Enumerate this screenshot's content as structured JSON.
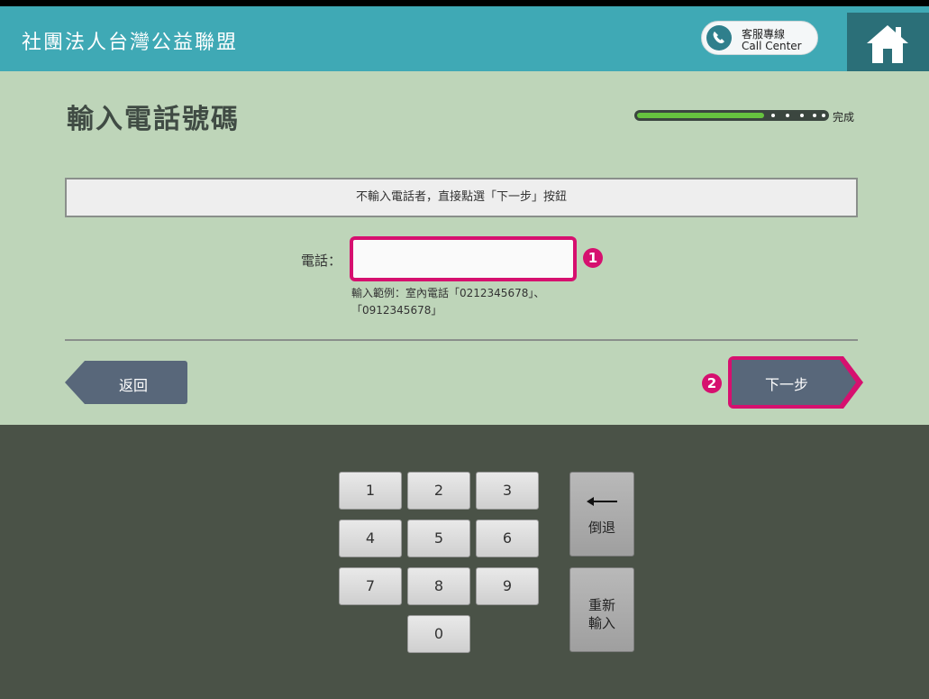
{
  "header": {
    "org_name": "社團法人台灣公益聯盟",
    "call_center_line1": "客服專線",
    "call_center_line2": "Call Center",
    "home_icon": "home-icon",
    "phone_icon": "phone-icon"
  },
  "page": {
    "title": "輸入電話號碼",
    "progress_label": "完成",
    "progress_fraction": 0.67,
    "notice": "不輸入電話者，直接點選「下一步」按鈕"
  },
  "form": {
    "phone_label": "電話：",
    "phone_value": "",
    "phone_placeholder": "",
    "hint_line1": "輸入範例：室內電話「0212345678」、",
    "hint_line2": "「0912345678」",
    "badge1": "1",
    "badge2": "2"
  },
  "nav": {
    "back_label": "返回",
    "next_label": "下一步"
  },
  "keypad": {
    "keys": [
      "1",
      "2",
      "3",
      "4",
      "5",
      "6",
      "7",
      "8",
      "9",
      "0"
    ],
    "backspace_label": "倒退",
    "reset_label_line1": "重新",
    "reset_label_line2": "輸入"
  },
  "colors": {
    "header": "#3fa9b5",
    "content_bg": "#bed5b9",
    "keypad_bg": "#4a5247",
    "highlight": "#d6106f",
    "button": "#58677a",
    "progress": "#66c33f"
  }
}
